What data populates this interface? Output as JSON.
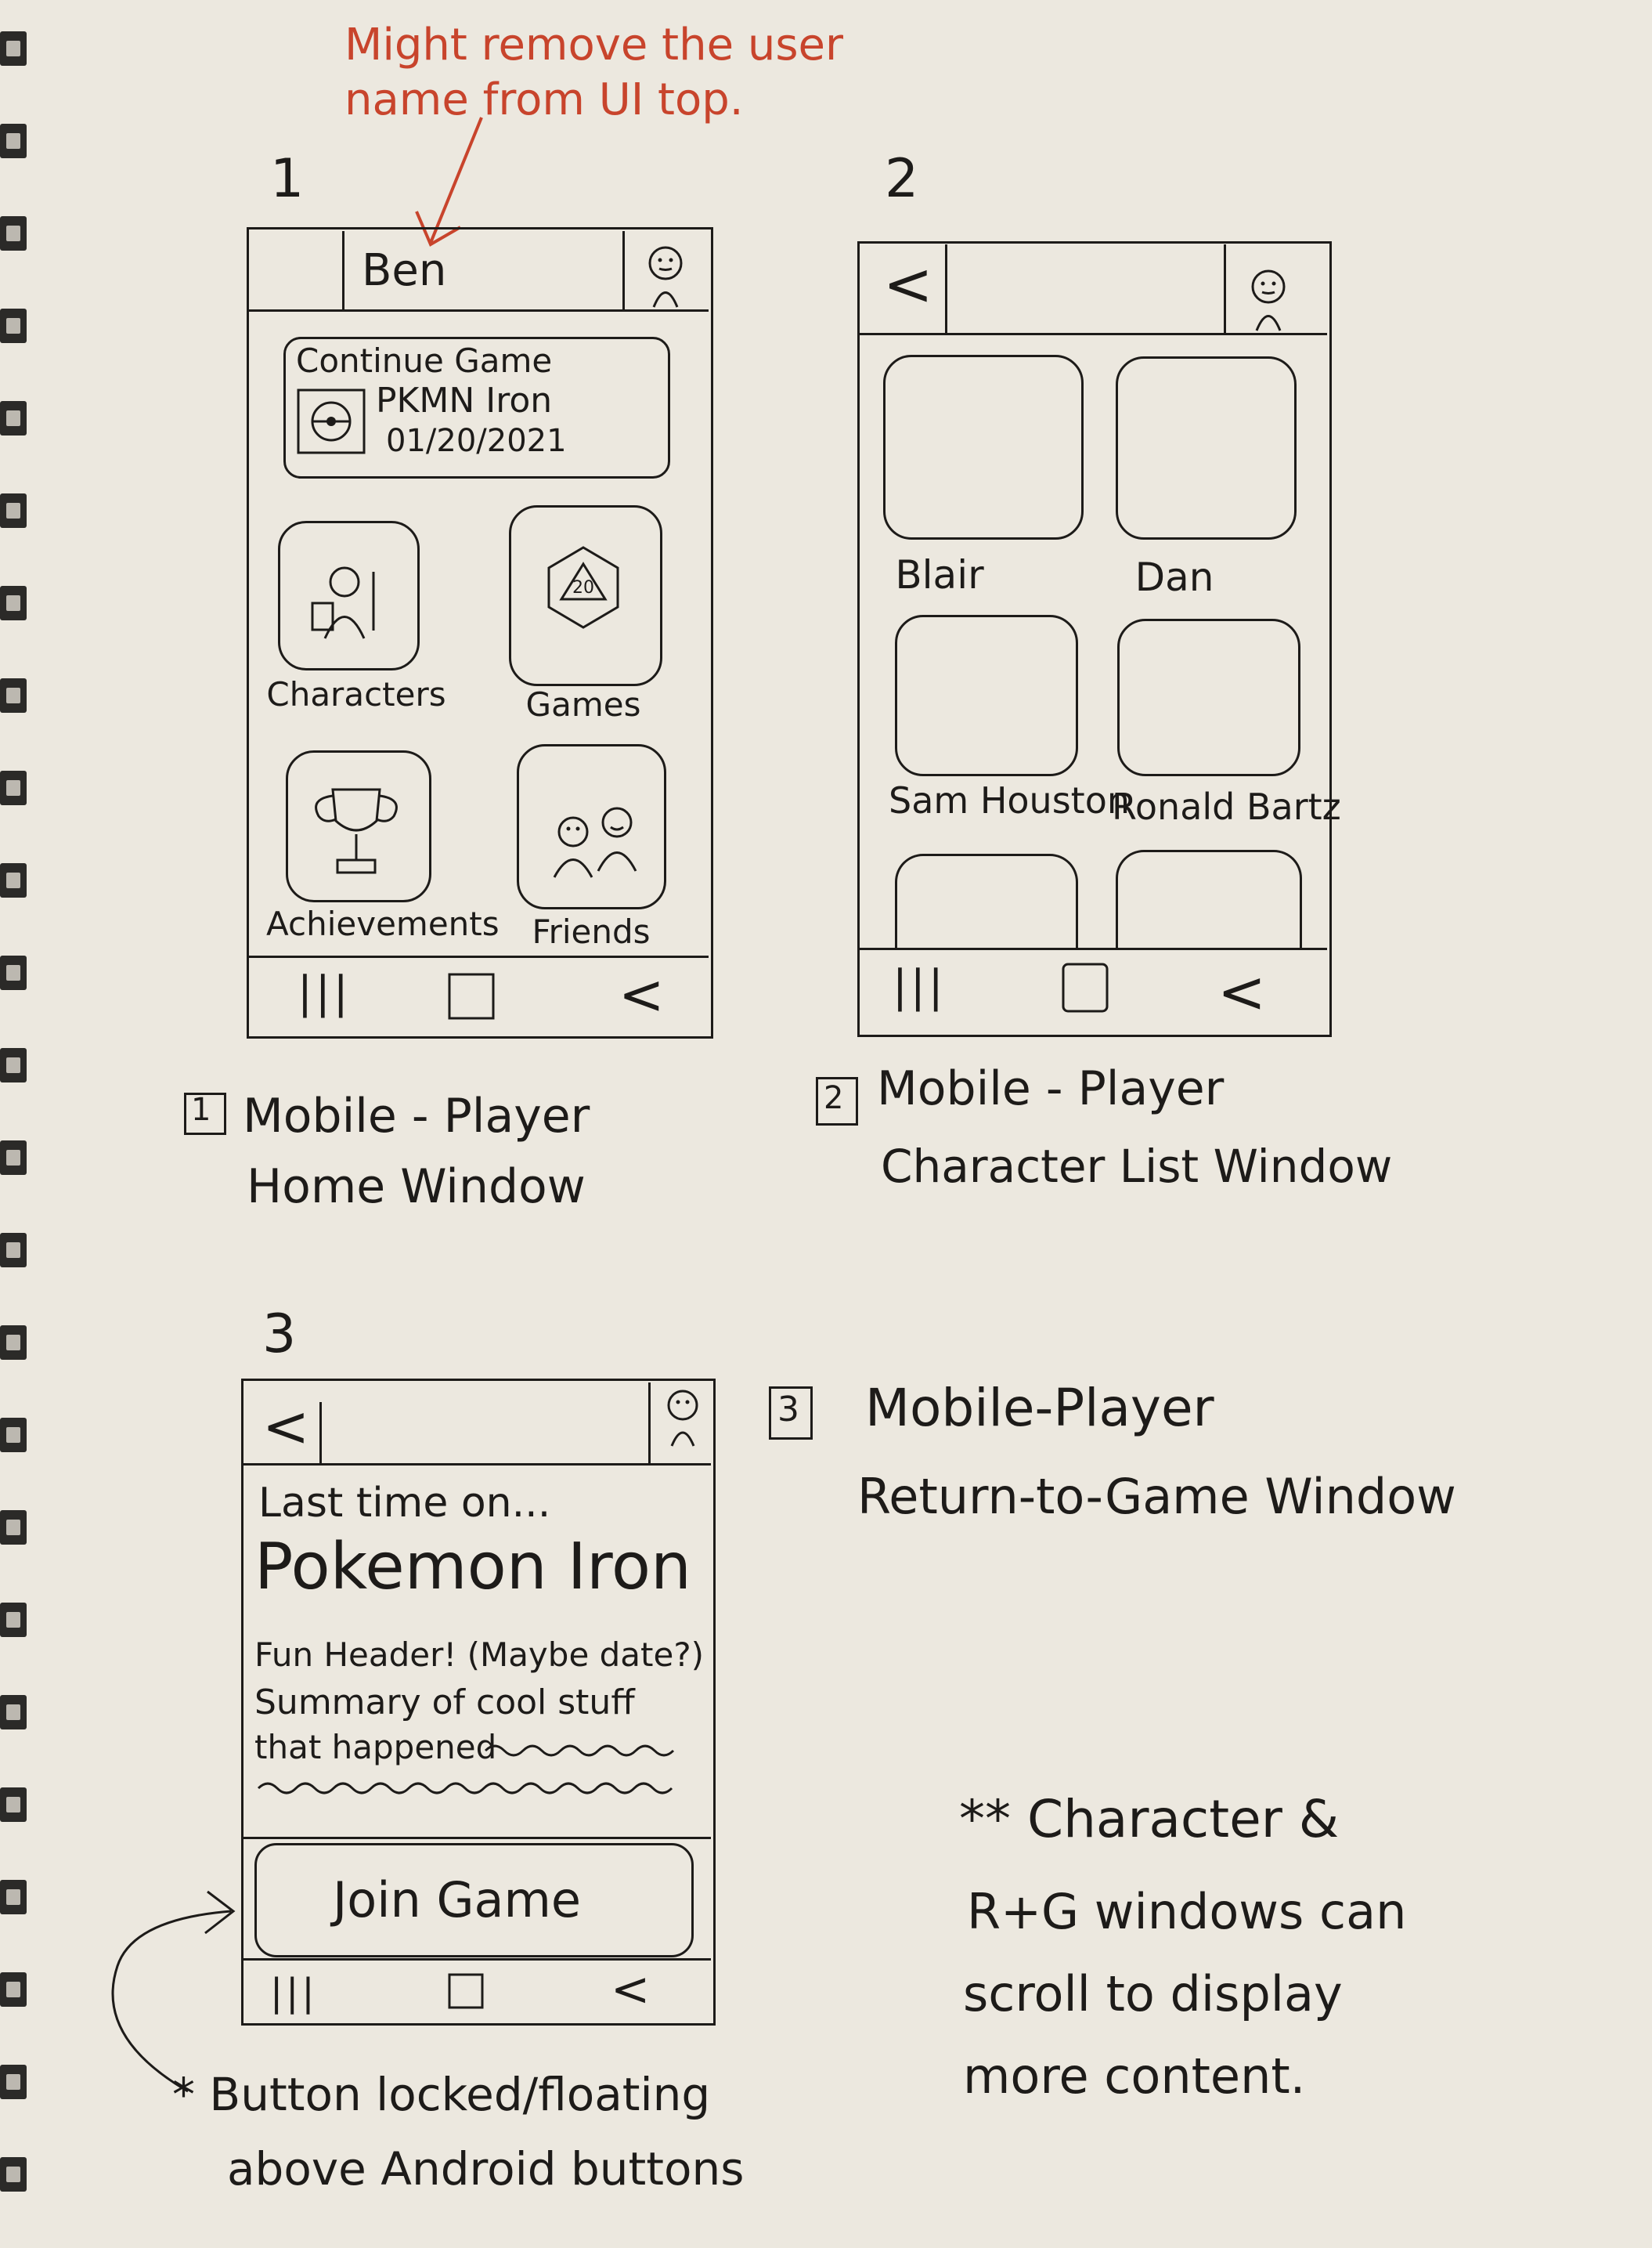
{
  "annotation_top": {
    "line1": "Might remove the user",
    "line2": "name from UI top."
  },
  "screen1": {
    "number": "1",
    "username": "Ben",
    "continue": {
      "title": "Continue Game",
      "game": "PKMN Iron",
      "date": "01/20/2021"
    },
    "tiles": [
      "Characters",
      "Games",
      "Achievements",
      "Friends"
    ],
    "dice_label": "20",
    "caption_number": "1",
    "caption_line1": "Mobile - Player",
    "caption_line2": "Home Window"
  },
  "screen2": {
    "number": "2",
    "back": "<",
    "characters": [
      "Blair",
      "Dan",
      "Sam Houston",
      "Ronald Bartz"
    ],
    "caption_number": "2",
    "caption_line1": "Mobile - Player",
    "caption_line2": "Character List Window"
  },
  "screen3": {
    "number": "3",
    "back": "<",
    "intro": "Last time on...",
    "title": "Pokemon Iron",
    "header": "Fun Header! (Maybe date?)",
    "summary1": "Summary of cool stuff",
    "summary2": "that happened",
    "join": "Join Game",
    "caption_number": "3",
    "caption_line1": "Mobile-Player",
    "caption_line2": "Return-to-Game Window"
  },
  "navbar": {
    "recents": "|||",
    "back": "<"
  },
  "note_button": {
    "line1": "* Button locked/floating",
    "line2": "above Android buttons"
  },
  "note_scroll": {
    "line1": "** Character &",
    "line2": "R+G windows can",
    "line3": "scroll to display",
    "line4": "more content."
  },
  "colors": {
    "ink": "#1d1b19",
    "annotation": "#c8442c",
    "paper": "#ece8df"
  }
}
